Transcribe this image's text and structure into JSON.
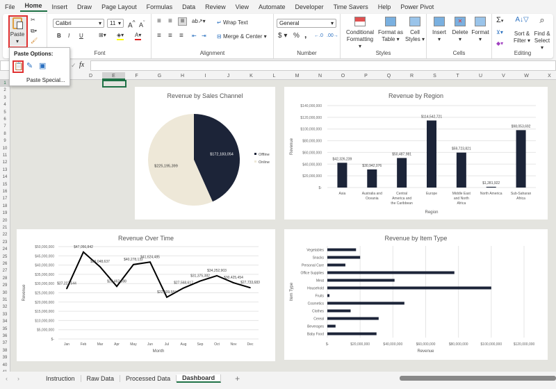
{
  "menu_tabs": [
    "File",
    "Home",
    "Insert",
    "Draw",
    "Page Layout",
    "Formulas",
    "Data",
    "Review",
    "View",
    "Automate",
    "Developer",
    "Time Savers",
    "Help",
    "Power Pivot"
  ],
  "active_tab": "Home",
  "ribbon": {
    "paste": "Paste",
    "font": {
      "name": "Calibri",
      "size": "11",
      "bold": "B",
      "italic": "I",
      "underline": "U",
      "label": "Font"
    },
    "alignment": {
      "wrap": "Wrap Text",
      "merge": "Merge & Center",
      "label": "Alignment"
    },
    "number": {
      "format": "General",
      "currency": "$",
      "percent": "%",
      "comma": ",",
      "label": "Number"
    },
    "styles": {
      "conditional": "Conditional",
      "conditional2": "Formatting",
      "format_table": "Format as",
      "format_table2": "Table",
      "cell_styles": "Cell",
      "cell_styles2": "Styles",
      "label": "Styles"
    },
    "cells": {
      "insert": "Insert",
      "delete": "Delete",
      "format": "Format",
      "label": "Cells"
    },
    "editing": {
      "sort": "Sort &",
      "sort2": "Filter",
      "find": "Find &",
      "find2": "Select",
      "label": "Editing"
    }
  },
  "paste_popup": {
    "title": "Paste Options:",
    "special": "Paste Special..."
  },
  "formula_bar": {
    "fx": "fx",
    "value": ""
  },
  "columns": [
    "D",
    "E",
    "F",
    "G",
    "H",
    "I",
    "J",
    "K",
    "L",
    "M",
    "N",
    "O",
    "P",
    "Q",
    "R",
    "S",
    "T",
    "U",
    "V",
    "W",
    "X"
  ],
  "sheets": [
    "Instruction",
    "Raw Data",
    "Processed Data",
    "Dashboard"
  ],
  "active_sheet": "Dashboard",
  "colors": {
    "navy": "#1c2438",
    "cream": "#eee8d8",
    "accent": "#1e7145"
  },
  "chart_data": [
    {
      "type": "pie",
      "title": "Revenue by Sales Channel",
      "categories": [
        "Offline",
        "Online"
      ],
      "values": [
        172183054,
        225195399
      ],
      "labels": [
        "$172,183,054",
        "$225,195,399"
      ],
      "legend": "right"
    },
    {
      "type": "bar",
      "title": "Revenue by Region",
      "xlabel": "Region",
      "ylabel": "Revenue",
      "ylim": [
        0,
        140000000
      ],
      "categories": [
        "Asia",
        "Australia and Oceania",
        "Central America and the Caribbean",
        "Europe",
        "Middle East and North Africa",
        "North America",
        "Sub-Saharan Africa"
      ],
      "values": [
        42326239,
        30942076,
        50487981,
        114542721,
        59723821,
        1281922,
        98053692
      ],
      "labels": [
        "$42,326,239",
        "$30,942,076",
        "$50,487,981",
        "$114,542,721",
        "$59,723,821",
        "$1,281,922",
        "$98,053,692"
      ],
      "yticks": [
        "$-",
        "$20,000,000",
        "$40,000,000",
        "$60,000,000",
        "$80,000,000",
        "$100,000,000",
        "$120,000,000",
        "$140,000,000"
      ]
    },
    {
      "type": "line",
      "title": "Revenue Over Time",
      "xlabel": "Month",
      "ylabel": "Revenue",
      "ylim": [
        0,
        50000000
      ],
      "categories": [
        "Jan",
        "Feb",
        "Mar",
        "Apr",
        "May",
        "Jun",
        "Jul",
        "Aug",
        "Sep",
        "Oct",
        "Nov",
        "Dec"
      ],
      "values": [
        27227544,
        47056842,
        39048637,
        28462888,
        40278132,
        41624485,
        22609584,
        27568617,
        31375382,
        34252903,
        30425454,
        27733683
      ],
      "labels": [
        "$27,227,544",
        "$47,056,842",
        "$39,048,637",
        "$28,462,888",
        "$40,278,132",
        "$41,624,485",
        "$22,609,584",
        "$27,568,617",
        "$31,375,382",
        "$34,252,903",
        "$30,425,454",
        "$27,733,683"
      ],
      "yticks": [
        "$-",
        "$5,000,000",
        "$10,000,000",
        "$15,000,000",
        "$20,000,000",
        "$25,000,000",
        "$30,000,000",
        "$35,000,000",
        "$40,000,000",
        "$45,000,000",
        "$50,000,000"
      ]
    },
    {
      "type": "bar-horizontal",
      "title": "Revenue by Item Type",
      "xlabel": "Revenue",
      "ylabel": "Item Type",
      "xlim": [
        0,
        120000000
      ],
      "categories": [
        "Vegetables",
        "Snacks",
        "Personal Care",
        "Office Supplies",
        "Meat",
        "Household",
        "Fruits",
        "Cosmetics",
        "Clothes",
        "Cereal",
        "Beverages",
        "Baby Food"
      ],
      "values": [
        17500000,
        20000000,
        11000000,
        77500000,
        41000000,
        100000000,
        1300000,
        47000000,
        14200000,
        31300000,
        5000000,
        30000000
      ],
      "xticks": [
        "$-",
        "$20,000,000",
        "$40,000,000",
        "$60,000,000",
        "$80,000,000",
        "$100,000,000",
        "$120,000,000"
      ]
    }
  ]
}
